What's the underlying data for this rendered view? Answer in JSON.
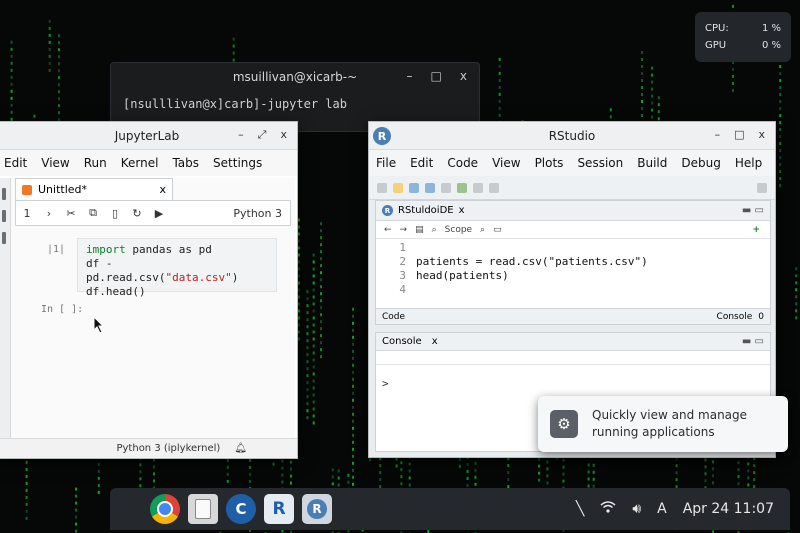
{
  "perf": {
    "cpu_label": "CPU:",
    "cpu_value": "1 %",
    "gpu_label": "GPU",
    "gpu_value": "0 %"
  },
  "terminal": {
    "title": "msuillivan@xicarb-~",
    "minimize": "–",
    "maximize": "□",
    "close": "x",
    "command": "[nsulllivan@x]carb]-jupyter lab"
  },
  "jupyter": {
    "title": "JupyterLab",
    "controls": {
      "minimize": "–",
      "maximize": "⤢",
      "close": "x"
    },
    "menu": [
      "Edit",
      "View",
      "Run",
      "Kernel",
      "Tabs",
      "Settings"
    ],
    "tab": {
      "label": "Unittled*",
      "close": "x"
    },
    "toolbar": {
      "cell_num": "1",
      "kernel": "Python 3"
    },
    "cell": {
      "prompt": "|1|",
      "line1_kw": "import",
      "line1_rest": " pandas as pd",
      "line2_pre": "df - pd.read.csv(",
      "line2_str": "\"data.csv\"",
      "line2_post": ")",
      "line3": "df.head()"
    },
    "empty_prompt": "In [ ]:",
    "status": "Python 3 (iplykernel)"
  },
  "rstudio": {
    "title": "RStudio",
    "logo": "R",
    "controls": {
      "minimize": "–",
      "maximize": "□",
      "close": "x"
    },
    "menu": [
      "File",
      "Edit",
      "Code",
      "View",
      "Plots",
      "Session",
      "Build",
      "Debug",
      "Help"
    ],
    "editor": {
      "tab_label": "RStuldoiDE",
      "tab_close": "x",
      "scope": "Scope",
      "plus": "+",
      "line_numbers": [
        "1",
        "2",
        "3",
        "4"
      ],
      "lines": [
        "",
        "patients = read.csv(\"patients.csv\")",
        "head(patients)",
        ""
      ],
      "footer_left": "Code",
      "footer_right": "Console",
      "footer_count": "0"
    },
    "console": {
      "tab_label": "Console",
      "tab_close": "x",
      "prompt": ">"
    }
  },
  "tooltip": {
    "line1": "Quickly view and manage",
    "line2": "running applications"
  },
  "taskbar": {
    "apps": [
      {
        "name": "chrome-app",
        "label": ""
      },
      {
        "name": "files-app",
        "label": ""
      },
      {
        "name": "c-app",
        "label": "C"
      },
      {
        "name": "r-app",
        "label": "R"
      },
      {
        "name": "rstudio-app",
        "label": "R"
      }
    ],
    "tray": {
      "keyboard": "A",
      "datetime": "Apr 24 11:07"
    }
  }
}
